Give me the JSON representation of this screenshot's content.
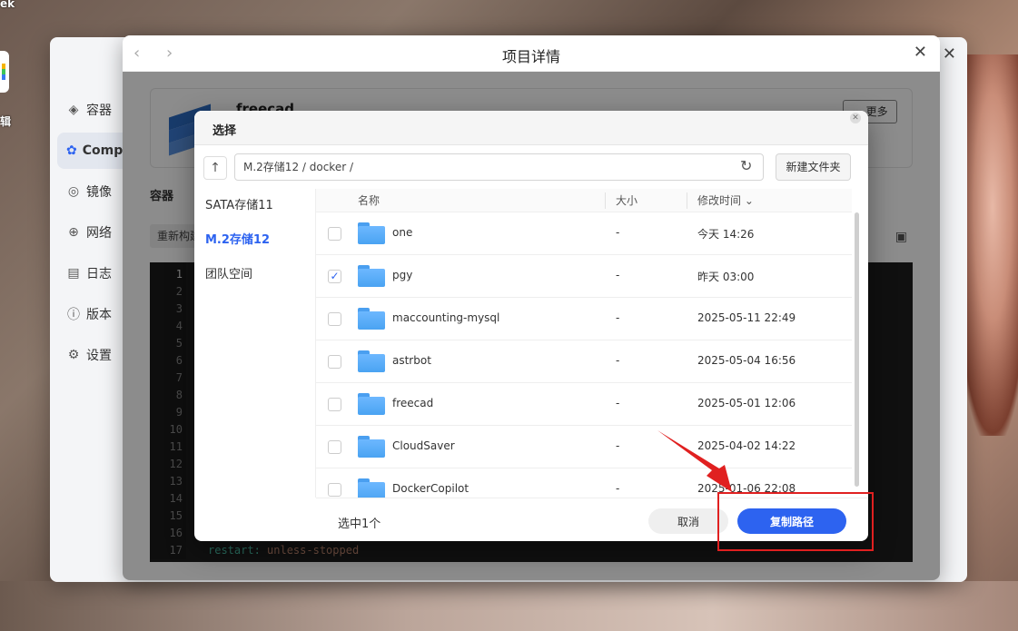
{
  "desktop": {
    "label_top": "ek",
    "label_side": "辑"
  },
  "app": {
    "nav": [
      {
        "label": "容器",
        "icon": "layers-icon"
      },
      {
        "label": "Compose",
        "icon": "compose-icon"
      },
      {
        "label": "镜像",
        "icon": "disc-icon"
      },
      {
        "label": "网络",
        "icon": "globe-icon"
      },
      {
        "label": "日志",
        "icon": "log-icon"
      },
      {
        "label": "版本",
        "icon": "info-icon"
      },
      {
        "label": "设置",
        "icon": "gear-icon"
      }
    ]
  },
  "detail": {
    "title": "项目详情",
    "project_name": "freecad",
    "more_label": "··· 更多",
    "tab_label": "容器",
    "rebuild_label": "重新构建",
    "line_numbers": [
      "1",
      "2",
      "3",
      "4",
      "5",
      "6",
      "7",
      "8",
      "9",
      "10",
      "11",
      "12",
      "13",
      "14",
      "15",
      "16",
      "17"
    ],
    "code_key": "restart:",
    "code_value": " unless-stopped"
  },
  "picker": {
    "title": "选择",
    "path": "M.2存储12 / docker /",
    "new_folder_label": "新建文件夹",
    "locations": [
      "SATA存储11",
      "M.2存储12",
      "团队空间"
    ],
    "active_location": "M.2存储12",
    "columns": {
      "name": "名称",
      "size": "大小",
      "modified": "修改时间 ⌄"
    },
    "files": [
      {
        "name": "one",
        "size": "-",
        "modified": "今天 14:26",
        "checked": false
      },
      {
        "name": "pgy",
        "size": "-",
        "modified": "昨天 03:00",
        "checked": true
      },
      {
        "name": "maccounting-mysql",
        "size": "-",
        "modified": "2025-05-11 22:49",
        "checked": false
      },
      {
        "name": "astrbot",
        "size": "-",
        "modified": "2025-05-04 16:56",
        "checked": false
      },
      {
        "name": "freecad",
        "size": "-",
        "modified": "2025-05-01 12:06",
        "checked": false
      },
      {
        "name": "CloudSaver",
        "size": "-",
        "modified": "2025-04-02 14:22",
        "checked": false
      },
      {
        "name": "DockerCopilot",
        "size": "-",
        "modified": "2025-01-06 22:08",
        "checked": false
      }
    ],
    "selected_count_label": "选中1个",
    "cancel_label": "取消",
    "copy_path_label": "复制路径"
  },
  "colors": {
    "accent": "#2d63f0",
    "annotation": "#e02020"
  }
}
